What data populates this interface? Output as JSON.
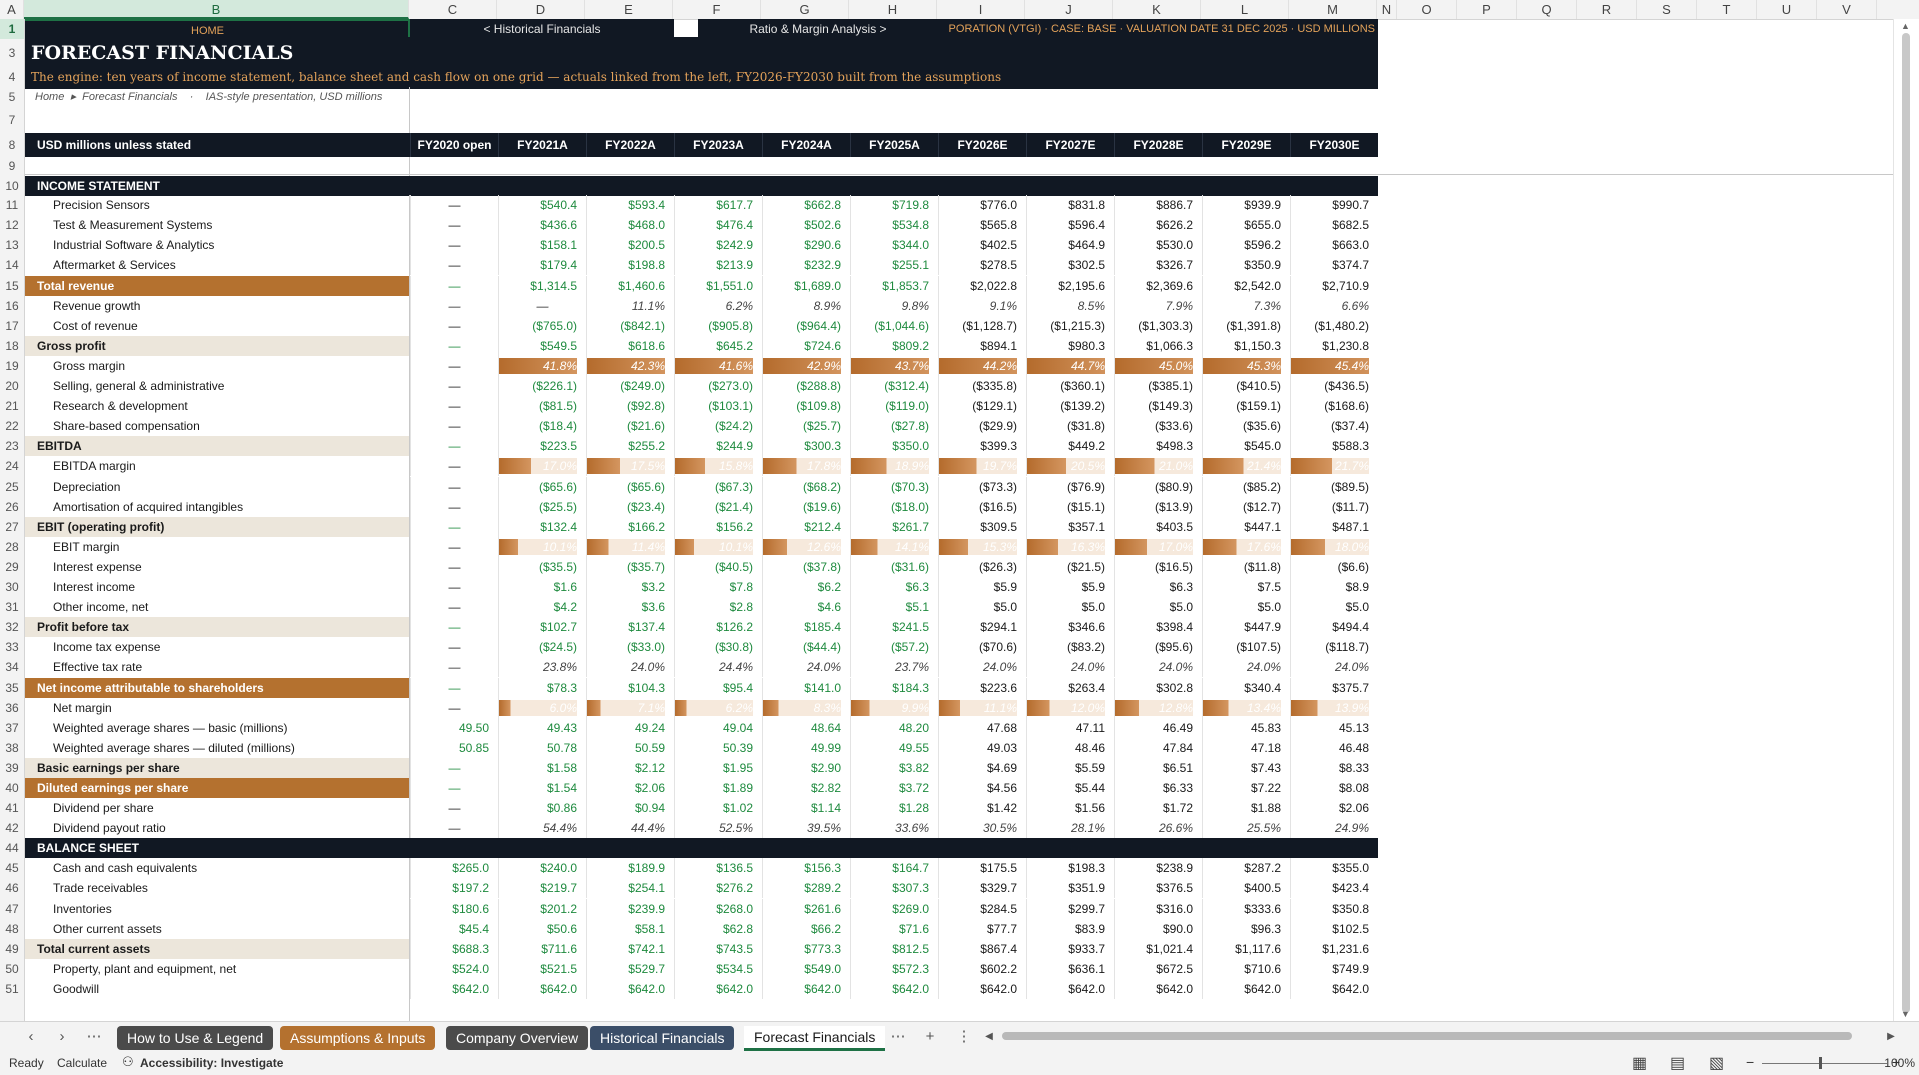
{
  "columns": [
    {
      "key": "A",
      "w": 24
    },
    {
      "key": "B",
      "w": 385
    },
    {
      "key": "C",
      "w": 88
    },
    {
      "key": "D",
      "w": 88
    },
    {
      "key": "E",
      "w": 88
    },
    {
      "key": "F",
      "w": 88
    },
    {
      "key": "G",
      "w": 88
    },
    {
      "key": "H",
      "w": 88
    },
    {
      "key": "I",
      "w": 88
    },
    {
      "key": "J",
      "w": 88
    },
    {
      "key": "K",
      "w": 88
    },
    {
      "key": "L",
      "w": 88
    },
    {
      "key": "M",
      "w": 88
    },
    {
      "key": "N",
      "w": 20
    },
    {
      "key": "O",
      "w": 60
    },
    {
      "key": "P",
      "w": 60
    },
    {
      "key": "Q",
      "w": 60
    },
    {
      "key": "R",
      "w": 60
    },
    {
      "key": "S",
      "w": 60
    },
    {
      "key": "T",
      "w": 60
    },
    {
      "key": "U",
      "w": 60
    },
    {
      "key": "V",
      "w": 60
    }
  ],
  "colors": {
    "navy": "#111823",
    "brown": "#b4712f",
    "beige": "#ece6db",
    "green": "#1e8a3e",
    "accent_text": "#e3a25a"
  },
  "nav": {
    "home": "HOME",
    "historical": "< Historical Financials",
    "ratio": "Ratio & Margin Analysis >",
    "info": "PORATION (VTGI)  ·  CASE: BASE  ·  VALUATION DATE 31 DEC 2025  ·  USD MILLIONS"
  },
  "banner": {
    "title": "FORECAST FINANCIALS",
    "subtitle": "The engine: ten years of income statement, balance sheet and cash flow on one grid — actuals linked from the left, FY2026-FY2030 built from the assumptions"
  },
  "breadcrumb": {
    "home": "Home",
    "sep": "▸",
    "page": "Forecast Financials",
    "dot": "·",
    "note": "IAS-style presentation, USD millions"
  },
  "header": {
    "label": "USD millions unless stated",
    "periods": [
      "FY2020 open",
      "FY2021A",
      "FY2022A",
      "FY2023A",
      "FY2024A",
      "FY2025A",
      "FY2026E",
      "FY2027E",
      "FY2028E",
      "FY2029E",
      "FY2030E"
    ]
  },
  "rows": [
    {
      "r": 10,
      "type": "section",
      "label": "INCOME STATEMENT"
    },
    {
      "r": 11,
      "type": "line",
      "label": "Precision Sensors",
      "values": [
        "—",
        "$540.4",
        "$593.4",
        "$617.7",
        "$662.8",
        "$719.8",
        "$776.0",
        "$831.8",
        "$886.7",
        "$939.9",
        "$990.7"
      ]
    },
    {
      "r": 12,
      "type": "line",
      "label": "Test & Measurement Systems",
      "values": [
        "—",
        "$436.6",
        "$468.0",
        "$476.4",
        "$502.6",
        "$534.8",
        "$565.8",
        "$596.4",
        "$626.2",
        "$655.0",
        "$682.5"
      ]
    },
    {
      "r": 13,
      "type": "line",
      "label": "Industrial Software & Analytics",
      "values": [
        "—",
        "$158.1",
        "$200.5",
        "$242.9",
        "$290.6",
        "$344.0",
        "$402.5",
        "$464.9",
        "$530.0",
        "$596.2",
        "$663.0"
      ]
    },
    {
      "r": 14,
      "type": "line",
      "label": "Aftermarket & Services",
      "values": [
        "—",
        "$179.4",
        "$198.8",
        "$213.9",
        "$232.9",
        "$255.1",
        "$278.5",
        "$302.5",
        "$326.7",
        "$350.9",
        "$374.7"
      ]
    },
    {
      "r": 15,
      "type": "keytotal",
      "label": "Total revenue",
      "values": [
        "—",
        "$1,314.5",
        "$1,460.6",
        "$1,551.0",
        "$1,689.0",
        "$1,853.7",
        "$2,022.8",
        "$2,195.6",
        "$2,369.6",
        "$2,542.0",
        "$2,710.9"
      ]
    },
    {
      "r": 16,
      "type": "pct",
      "label": "Revenue growth",
      "values": [
        "—",
        "—",
        "11.1%",
        "6.2%",
        "8.9%",
        "9.8%",
        "9.1%",
        "8.5%",
        "7.9%",
        "7.3%",
        "6.6%"
      ]
    },
    {
      "r": 17,
      "type": "line",
      "label": "Cost of revenue",
      "values": [
        "—",
        "($765.0)",
        "($842.1)",
        "($905.8)",
        "($964.4)",
        "($1,044.6)",
        "($1,128.7)",
        "($1,215.3)",
        "($1,303.3)",
        "($1,391.8)",
        "($1,480.2)"
      ]
    },
    {
      "r": 18,
      "type": "subtotal",
      "label": "Gross profit",
      "values": [
        "—",
        "$549.5",
        "$618.6",
        "$645.2",
        "$724.6",
        "$809.2",
        "$894.1",
        "$980.3",
        "$1,066.3",
        "$1,150.3",
        "$1,230.8"
      ]
    },
    {
      "r": 19,
      "type": "bar",
      "label": "Gross margin",
      "values": [
        "—",
        "41.8%",
        "42.3%",
        "41.6%",
        "42.9%",
        "43.7%",
        "44.2%",
        "44.7%",
        "45.0%",
        "45.3%",
        "45.4%"
      ],
      "levels": [
        0,
        0.418,
        0.423,
        0.416,
        0.429,
        0.437,
        0.442,
        0.447,
        0.45,
        0.453,
        0.454
      ]
    },
    {
      "r": 20,
      "type": "line",
      "label": "Selling, general & administrative",
      "values": [
        "—",
        "($226.1)",
        "($249.0)",
        "($273.0)",
        "($288.8)",
        "($312.4)",
        "($335.8)",
        "($360.1)",
        "($385.1)",
        "($410.5)",
        "($436.5)"
      ]
    },
    {
      "r": 21,
      "type": "line",
      "label": "Research & development",
      "values": [
        "—",
        "($81.5)",
        "($92.8)",
        "($103.1)",
        "($109.8)",
        "($119.0)",
        "($129.1)",
        "($139.2)",
        "($149.3)",
        "($159.1)",
        "($168.6)"
      ]
    },
    {
      "r": 22,
      "type": "line",
      "label": "Share-based compensation",
      "values": [
        "—",
        "($18.4)",
        "($21.6)",
        "($24.2)",
        "($25.7)",
        "($27.8)",
        "($29.9)",
        "($31.8)",
        "($33.6)",
        "($35.6)",
        "($37.4)"
      ]
    },
    {
      "r": 23,
      "type": "subtotal",
      "label": "EBITDA",
      "values": [
        "—",
        "$223.5",
        "$255.2",
        "$244.9",
        "$300.3",
        "$350.0",
        "$399.3",
        "$449.2",
        "$498.3",
        "$545.0",
        "$588.3"
      ]
    },
    {
      "r": 24,
      "type": "bar",
      "label": "EBITDA margin",
      "values": [
        "—",
        "17.0%",
        "17.5%",
        "15.8%",
        "17.8%",
        "18.9%",
        "19.7%",
        "20.5%",
        "21.0%",
        "21.4%",
        "21.7%"
      ],
      "levels": [
        0,
        0.17,
        0.175,
        0.158,
        0.178,
        0.189,
        0.197,
        0.205,
        0.21,
        0.214,
        0.217
      ]
    },
    {
      "r": 25,
      "type": "line",
      "label": "Depreciation",
      "values": [
        "—",
        "($65.6)",
        "($65.6)",
        "($67.3)",
        "($68.2)",
        "($70.3)",
        "($73.3)",
        "($76.9)",
        "($80.9)",
        "($85.2)",
        "($89.5)"
      ]
    },
    {
      "r": 26,
      "type": "line",
      "label": "Amortisation of acquired intangibles",
      "values": [
        "—",
        "($25.5)",
        "($23.4)",
        "($21.4)",
        "($19.6)",
        "($18.0)",
        "($16.5)",
        "($15.1)",
        "($13.9)",
        "($12.7)",
        "($11.7)"
      ]
    },
    {
      "r": 27,
      "type": "subtotal",
      "label": "EBIT (operating profit)",
      "values": [
        "—",
        "$132.4",
        "$166.2",
        "$156.2",
        "$212.4",
        "$261.7",
        "$309.5",
        "$357.1",
        "$403.5",
        "$447.1",
        "$487.1"
      ]
    },
    {
      "r": 28,
      "type": "bar",
      "label": "EBIT margin",
      "values": [
        "—",
        "10.1%",
        "11.4%",
        "10.1%",
        "12.6%",
        "14.1%",
        "15.3%",
        "16.3%",
        "17.0%",
        "17.6%",
        "18.0%"
      ],
      "levels": [
        0,
        0.101,
        0.114,
        0.101,
        0.126,
        0.141,
        0.153,
        0.163,
        0.17,
        0.176,
        0.18
      ]
    },
    {
      "r": 29,
      "type": "line",
      "label": "Interest expense",
      "values": [
        "—",
        "($35.5)",
        "($35.7)",
        "($40.5)",
        "($37.8)",
        "($31.6)",
        "($26.3)",
        "($21.5)",
        "($16.5)",
        "($11.8)",
        "($6.6)"
      ]
    },
    {
      "r": 30,
      "type": "line",
      "label": "Interest income",
      "values": [
        "—",
        "$1.6",
        "$3.2",
        "$7.8",
        "$6.2",
        "$6.3",
        "$5.9",
        "$5.9",
        "$6.3",
        "$7.5",
        "$8.9"
      ]
    },
    {
      "r": 31,
      "type": "line",
      "label": "Other income, net",
      "values": [
        "—",
        "$4.2",
        "$3.6",
        "$2.8",
        "$4.6",
        "$5.1",
        "$5.0",
        "$5.0",
        "$5.0",
        "$5.0",
        "$5.0"
      ]
    },
    {
      "r": 32,
      "type": "subtotal",
      "label": "Profit before tax",
      "values": [
        "—",
        "$102.7",
        "$137.4",
        "$126.2",
        "$185.4",
        "$241.5",
        "$294.1",
        "$346.6",
        "$398.4",
        "$447.9",
        "$494.4"
      ]
    },
    {
      "r": 33,
      "type": "line",
      "label": "Income tax expense",
      "values": [
        "—",
        "($24.5)",
        "($33.0)",
        "($30.8)",
        "($44.4)",
        "($57.2)",
        "($70.6)",
        "($83.2)",
        "($95.6)",
        "($107.5)",
        "($118.7)"
      ]
    },
    {
      "r": 34,
      "type": "pct",
      "label": "Effective tax rate",
      "values": [
        "—",
        "23.8%",
        "24.0%",
        "24.4%",
        "24.0%",
        "23.7%",
        "24.0%",
        "24.0%",
        "24.0%",
        "24.0%",
        "24.0%"
      ]
    },
    {
      "r": 35,
      "type": "keytotal",
      "label": "Net income attributable to shareholders",
      "values": [
        "—",
        "$78.3",
        "$104.3",
        "$95.4",
        "$141.0",
        "$184.3",
        "$223.6",
        "$263.4",
        "$302.8",
        "$340.4",
        "$375.7"
      ]
    },
    {
      "r": 36,
      "type": "bar",
      "label": "Net margin",
      "values": [
        "—",
        "6.0%",
        "7.1%",
        "6.2%",
        "8.3%",
        "9.9%",
        "11.1%",
        "12.0%",
        "12.8%",
        "13.4%",
        "13.9%"
      ],
      "levels": [
        0,
        0.06,
        0.071,
        0.062,
        0.083,
        0.099,
        0.111,
        0.12,
        0.128,
        0.134,
        0.139
      ]
    },
    {
      "r": 37,
      "type": "line",
      "label": "Weighted average shares — basic (millions)",
      "values": [
        "49.50",
        "49.43",
        "49.24",
        "49.04",
        "48.64",
        "48.20",
        "47.68",
        "47.11",
        "46.49",
        "45.83",
        "45.13"
      ]
    },
    {
      "r": 38,
      "type": "line",
      "label": "Weighted average shares — diluted (millions)",
      "values": [
        "50.85",
        "50.78",
        "50.59",
        "50.39",
        "49.99",
        "49.55",
        "49.03",
        "48.46",
        "47.84",
        "47.18",
        "46.48"
      ]
    },
    {
      "r": 39,
      "type": "subtotal",
      "label": "Basic earnings per share",
      "values": [
        "—",
        "$1.58",
        "$2.12",
        "$1.95",
        "$2.90",
        "$3.82",
        "$4.69",
        "$5.59",
        "$6.51",
        "$7.43",
        "$8.33"
      ]
    },
    {
      "r": 40,
      "type": "keytotal",
      "label": "Diluted earnings per share",
      "values": [
        "—",
        "$1.54",
        "$2.06",
        "$1.89",
        "$2.82",
        "$3.72",
        "$4.56",
        "$5.44",
        "$6.33",
        "$7.22",
        "$8.08"
      ]
    },
    {
      "r": 41,
      "type": "line",
      "label": "Dividend per share",
      "values": [
        "—",
        "$0.86",
        "$0.94",
        "$1.02",
        "$1.14",
        "$1.28",
        "$1.42",
        "$1.56",
        "$1.72",
        "$1.88",
        "$2.06"
      ]
    },
    {
      "r": 42,
      "type": "pct",
      "label": "Dividend payout ratio",
      "values": [
        "—",
        "54.4%",
        "44.4%",
        "52.5%",
        "39.5%",
        "33.6%",
        "30.5%",
        "28.1%",
        "26.6%",
        "25.5%",
        "24.9%"
      ]
    },
    {
      "r": 44,
      "type": "section",
      "label": "BALANCE SHEET"
    },
    {
      "r": 45,
      "type": "line",
      "label": "Cash and cash equivalents",
      "values": [
        "$265.0",
        "$240.0",
        "$189.9",
        "$136.5",
        "$156.3",
        "$164.7",
        "$175.5",
        "$198.3",
        "$238.9",
        "$287.2",
        "$355.0"
      ]
    },
    {
      "r": 46,
      "type": "line",
      "label": "Trade receivables",
      "values": [
        "$197.2",
        "$219.7",
        "$254.1",
        "$276.2",
        "$289.2",
        "$307.3",
        "$329.7",
        "$351.9",
        "$376.5",
        "$400.5",
        "$423.4"
      ]
    },
    {
      "r": 47,
      "type": "line",
      "label": "Inventories",
      "values": [
        "$180.6",
        "$201.2",
        "$239.9",
        "$268.0",
        "$261.6",
        "$269.0",
        "$284.5",
        "$299.7",
        "$316.0",
        "$333.6",
        "$350.8"
      ]
    },
    {
      "r": 48,
      "type": "line",
      "label": "Other current assets",
      "values": [
        "$45.4",
        "$50.6",
        "$58.1",
        "$62.8",
        "$66.2",
        "$71.6",
        "$77.7",
        "$83.9",
        "$90.0",
        "$96.3",
        "$102.5"
      ]
    },
    {
      "r": 49,
      "type": "subtotal",
      "label": "Total current assets",
      "values": [
        "$688.3",
        "$711.6",
        "$742.1",
        "$743.5",
        "$773.3",
        "$812.5",
        "$867.4",
        "$933.7",
        "$1,021.4",
        "$1,117.6",
        "$1,231.6"
      ]
    },
    {
      "r": 50,
      "type": "line",
      "label": "Property, plant and equipment, net",
      "values": [
        "$524.0",
        "$521.5",
        "$529.7",
        "$534.5",
        "$549.0",
        "$572.3",
        "$602.2",
        "$636.1",
        "$672.5",
        "$710.6",
        "$749.9"
      ]
    },
    {
      "r": 51,
      "type": "line",
      "label": "Goodwill",
      "values": [
        "$642.0",
        "$642.0",
        "$642.0",
        "$642.0",
        "$642.0",
        "$642.0",
        "$642.0",
        "$642.0",
        "$642.0",
        "$642.0",
        "$642.0"
      ]
    }
  ],
  "tabs": [
    {
      "label": "How to Use & Legend",
      "color": "#4b4b4b"
    },
    {
      "label": "Assumptions & Inputs",
      "color": "#b4712f"
    },
    {
      "label": "Company Overview",
      "color": "#4b4b4b"
    },
    {
      "label": "Historical Financials",
      "color": "#3b4e68"
    },
    {
      "label": "Forecast Financials",
      "color": "",
      "active": true
    }
  ],
  "tabnav": {
    "prev": "‹",
    "next": "›",
    "more": "⋯",
    "add": "+",
    "menu": "⋮"
  },
  "status": {
    "ready": "Ready",
    "calculate": "Calculate",
    "accessibility": "Accessibility: Investigate",
    "zoom": "100%"
  }
}
